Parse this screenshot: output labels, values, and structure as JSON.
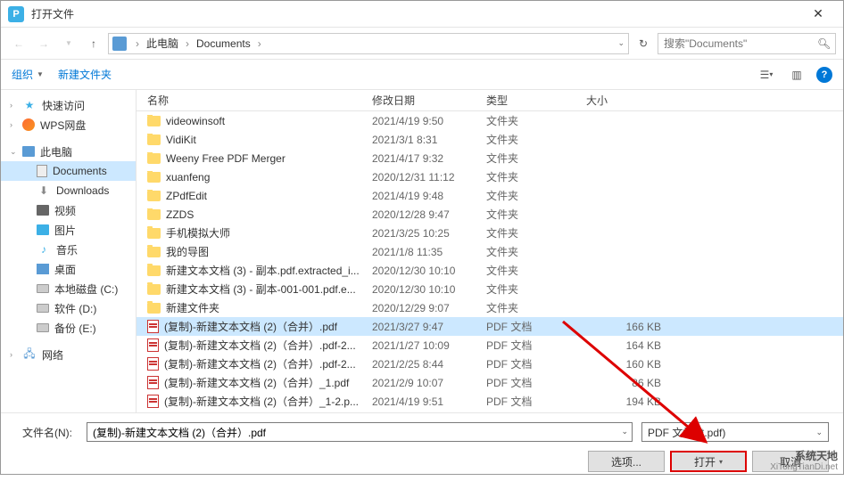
{
  "title": "打开文件",
  "nav": {
    "breadcrumb": [
      "此电脑",
      "Documents"
    ],
    "search_placeholder": "搜索\"Documents\""
  },
  "toolbar": {
    "organize": "组织",
    "newfolder": "新建文件夹"
  },
  "sidebar": [
    {
      "label": "快速访问",
      "icon": "star",
      "chev": true
    },
    {
      "label": "WPS网盘",
      "icon": "wps",
      "chev": true
    },
    {
      "spacer": true
    },
    {
      "label": "此电脑",
      "icon": "pc",
      "chev": "open"
    },
    {
      "label": "Documents",
      "icon": "doc",
      "indent": true,
      "selected": true
    },
    {
      "label": "Downloads",
      "icon": "dl",
      "indent": true
    },
    {
      "label": "视频",
      "icon": "vid",
      "indent": true
    },
    {
      "label": "图片",
      "icon": "img",
      "indent": true
    },
    {
      "label": "音乐",
      "icon": "mus",
      "indent": true
    },
    {
      "label": "桌面",
      "icon": "desk",
      "indent": true
    },
    {
      "label": "本地磁盘 (C:)",
      "icon": "drive",
      "indent": true
    },
    {
      "label": "软件 (D:)",
      "icon": "drive",
      "indent": true
    },
    {
      "label": "备份 (E:)",
      "icon": "drive",
      "indent": true
    },
    {
      "spacer": true
    },
    {
      "label": "网络",
      "icon": "net",
      "chev": true
    }
  ],
  "columns": {
    "name": "名称",
    "date": "修改日期",
    "type": "类型",
    "size": "大小"
  },
  "files": [
    {
      "name": "videowinsoft",
      "date": "2021/4/19 9:50",
      "type": "文件夹",
      "kind": "folder",
      "size": ""
    },
    {
      "name": "VidiKit",
      "date": "2021/3/1 8:31",
      "type": "文件夹",
      "kind": "folder",
      "size": ""
    },
    {
      "name": "Weeny Free PDF Merger",
      "date": "2021/4/17 9:32",
      "type": "文件夹",
      "kind": "folder",
      "size": ""
    },
    {
      "name": "xuanfeng",
      "date": "2020/12/31 11:12",
      "type": "文件夹",
      "kind": "folder",
      "size": ""
    },
    {
      "name": "ZPdfEdit",
      "date": "2021/4/19 9:48",
      "type": "文件夹",
      "kind": "folder",
      "size": ""
    },
    {
      "name": "ZZDS",
      "date": "2020/12/28 9:47",
      "type": "文件夹",
      "kind": "folder",
      "size": ""
    },
    {
      "name": "手机模拟大师",
      "date": "2021/3/25 10:25",
      "type": "文件夹",
      "kind": "folder",
      "size": ""
    },
    {
      "name": "我的导图",
      "date": "2021/1/8 11:35",
      "type": "文件夹",
      "kind": "folder",
      "size": ""
    },
    {
      "name": "新建文本文档 (3) - 副本.pdf.extracted_i...",
      "date": "2020/12/30 10:10",
      "type": "文件夹",
      "kind": "folder",
      "size": ""
    },
    {
      "name": "新建文本文档 (3) - 副本-001-001.pdf.e...",
      "date": "2020/12/30 10:10",
      "type": "文件夹",
      "kind": "folder",
      "size": ""
    },
    {
      "name": "新建文件夹",
      "date": "2020/12/29 9:07",
      "type": "文件夹",
      "kind": "folder",
      "size": ""
    },
    {
      "name": "(复制)-新建文本文档 (2)（合并）.pdf",
      "date": "2021/3/27 9:47",
      "type": "PDF 文档",
      "kind": "pdf",
      "size": "166 KB",
      "selected": true
    },
    {
      "name": "(复制)-新建文本文档 (2)（合并）.pdf-2...",
      "date": "2021/1/27 10:09",
      "type": "PDF 文档",
      "kind": "pdf",
      "size": "164 KB"
    },
    {
      "name": "(复制)-新建文本文档 (2)（合并）.pdf-2...",
      "date": "2021/2/25 8:44",
      "type": "PDF 文档",
      "kind": "pdf",
      "size": "160 KB"
    },
    {
      "name": "(复制)-新建文本文档 (2)（合并）_1.pdf",
      "date": "2021/2/9 10:07",
      "type": "PDF 文档",
      "kind": "pdf",
      "size": "86 KB"
    },
    {
      "name": "(复制)-新建文本文档 (2)（合并）_1-2.p...",
      "date": "2021/4/19 9:51",
      "type": "PDF 文档",
      "kind": "pdf",
      "size": "194 KB"
    }
  ],
  "filename": {
    "label": "文件名(N):",
    "value": "(复制)-新建文本文档 (2)（合并）.pdf"
  },
  "filter": "PDF 文档 (*.pdf)",
  "buttons": {
    "options": "选项...",
    "open": "打开",
    "cancel": "取消"
  },
  "watermark": {
    "l1": "系统天地",
    "l2": "XiTongTianDi.net"
  }
}
